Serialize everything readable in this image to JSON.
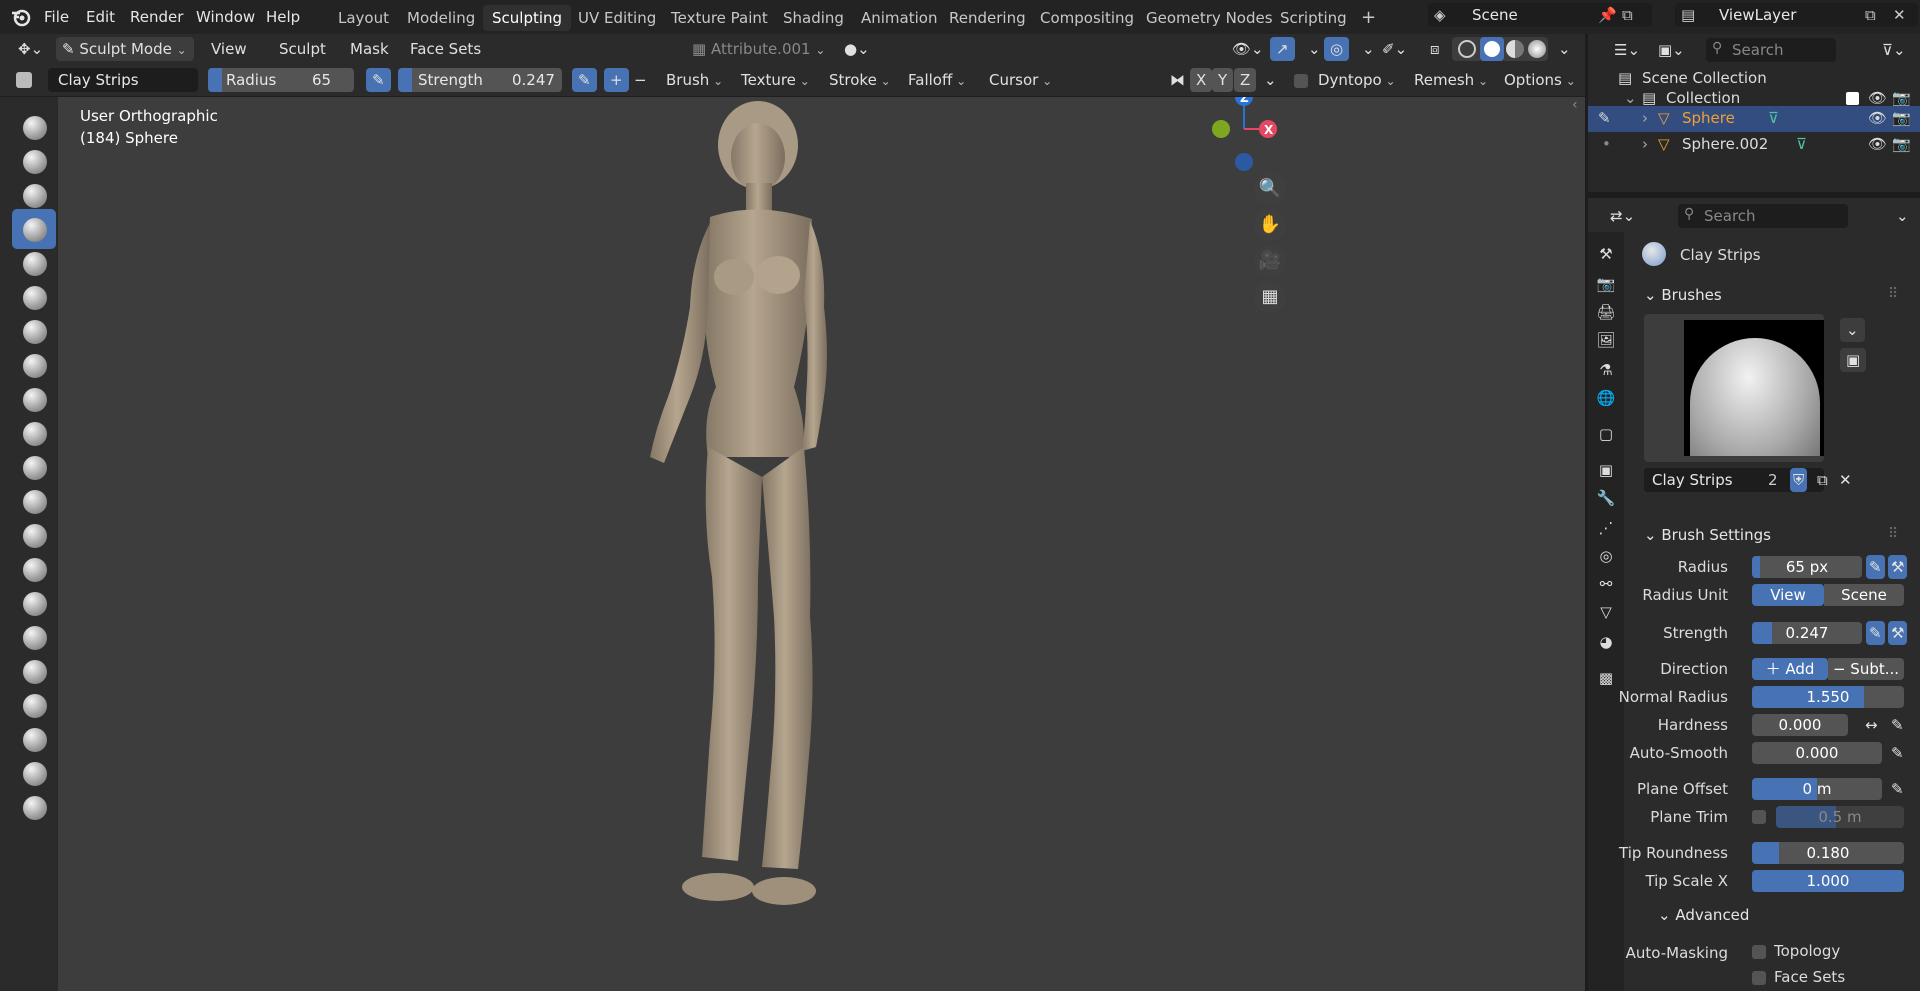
{
  "menubar": {
    "items": [
      "File",
      "Edit",
      "Render",
      "Window",
      "Help"
    ],
    "workspaces": [
      "Layout",
      "Modeling",
      "Sculpting",
      "UV Editing",
      "Texture Paint",
      "Shading",
      "Animation",
      "Rendering",
      "Compositing",
      "Geometry Nodes",
      "Scripting"
    ],
    "active_workspace": "Sculpting",
    "add_tab": "+",
    "scene": "Scene",
    "view_layer": "ViewLayer"
  },
  "header": {
    "mode": "Sculpt Mode",
    "menus": [
      "View",
      "Sculpt",
      "Mask",
      "Face Sets"
    ],
    "attribute": "Attribute.001"
  },
  "toolsettings": {
    "brush_name": "Clay Strips",
    "radius_label": "Radius",
    "radius_value": "65 px",
    "strength_label": "Strength",
    "strength_value": "0.247",
    "plus": "+",
    "minus": "−",
    "menus": [
      "Brush",
      "Texture",
      "Stroke",
      "Falloff",
      "Cursor"
    ],
    "axes": [
      "X",
      "Y",
      "Z"
    ],
    "dyntopo": "Dyntopo",
    "remesh": "Remesh",
    "options": "Options"
  },
  "viewport": {
    "view_name": "User Orthographic",
    "object_info": "(184) Sphere",
    "gizmo": {
      "z": "Z",
      "x": "X"
    }
  },
  "outliner": {
    "search_placeholder": "Search",
    "scene_collection": "Scene Collection",
    "collection": "Collection",
    "objects": [
      "Sphere",
      "Sphere.002"
    ]
  },
  "properties": {
    "search_placeholder": "Search",
    "tool_name": "Clay Strips",
    "brushes_header": "Brushes",
    "brush_name": "Clay Strips",
    "brush_users": "2",
    "brush_settings_header": "Brush Settings",
    "radius": {
      "label": "Radius",
      "value": "65 px"
    },
    "radius_unit": {
      "label": "Radius Unit",
      "options": [
        "View",
        "Scene"
      ],
      "selected": "View"
    },
    "strength": {
      "label": "Strength",
      "value": "0.247"
    },
    "direction": {
      "label": "Direction",
      "add": "Add",
      "subtract": "Subt..."
    },
    "normal_radius": {
      "label": "Normal Radius",
      "value": "1.550"
    },
    "hardness": {
      "label": "Hardness",
      "value": "0.000"
    },
    "auto_smooth": {
      "label": "Auto-Smooth",
      "value": "0.000"
    },
    "plane_offset": {
      "label": "Plane Offset",
      "value": "0 m"
    },
    "plane_trim": {
      "label": "Plane Trim",
      "value": "0.5 m"
    },
    "tip_roundness": {
      "label": "Tip Roundness",
      "value": "0.180"
    },
    "tip_scale_x": {
      "label": "Tip Scale X",
      "value": "1.000"
    },
    "advanced_header": "Advanced",
    "auto_masking": {
      "label": "Auto-Masking",
      "options": [
        "Topology",
        "Face Sets"
      ]
    }
  },
  "colors": {
    "accent": "#4772b3",
    "selected_object": "#f0a030",
    "viewport_bg": "#3d3d3d"
  }
}
